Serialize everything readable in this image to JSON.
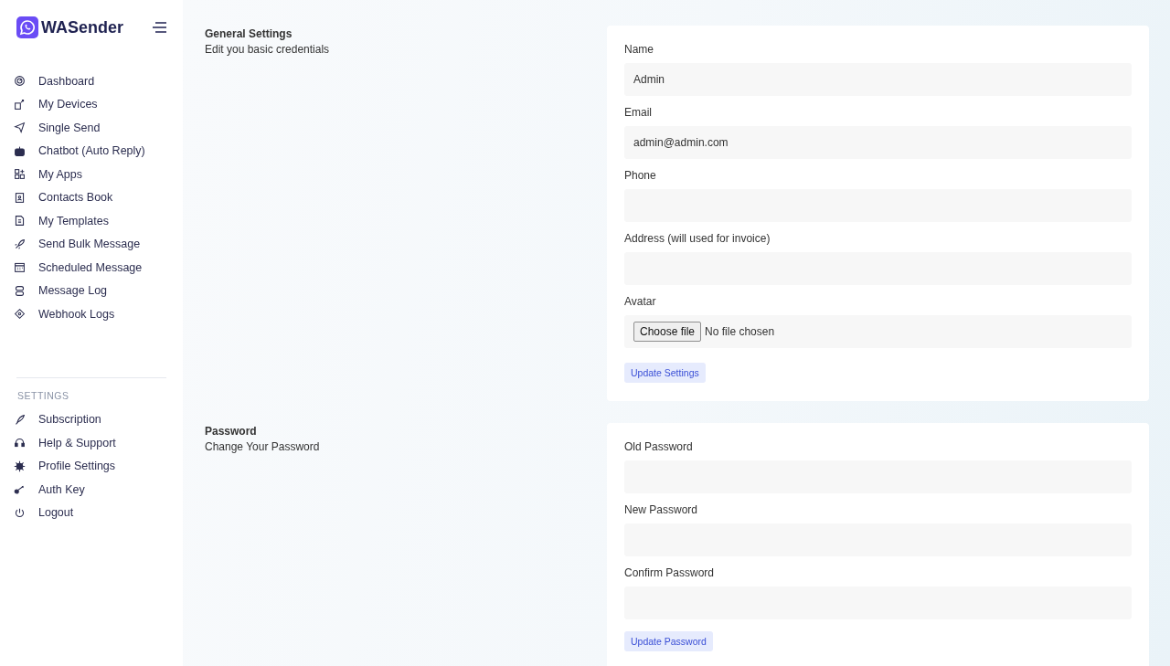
{
  "sidebar": {
    "brand": "WASender",
    "items": [
      {
        "label": "Dashboard",
        "selected": false
      },
      {
        "label": "My Devices",
        "selected": false
      },
      {
        "label": "Single Send",
        "selected": false
      },
      {
        "label": "Chatbot (Auto Reply)",
        "selected": false
      },
      {
        "label": "My Apps",
        "selected": false
      },
      {
        "label": "Contacts Book",
        "selected": false
      },
      {
        "label": "My Templates",
        "selected": false
      },
      {
        "label": "Send Bulk Message",
        "selected": false
      },
      {
        "label": "Scheduled Message",
        "selected": false
      },
      {
        "label": "Message Log",
        "selected": false
      },
      {
        "label": "Webhook Logs",
        "selected": false
      }
    ],
    "settings_heading": "SETTINGS",
    "settings_items": [
      {
        "label": "Subscription",
        "selected": false
      },
      {
        "label": "Help & Support",
        "selected": false
      },
      {
        "label": "Profile Settings",
        "selected": false
      },
      {
        "label": "Auth Key",
        "selected": false
      },
      {
        "label": "Logout",
        "selected": false
      }
    ]
  },
  "sections": [
    {
      "title": "General Settings",
      "subtitle": "Edit you basic credentials",
      "fields": [
        {
          "kind": "text",
          "label": "Name",
          "value": "Admin"
        },
        {
          "kind": "text",
          "label": "Email",
          "value": "admin@admin.com"
        },
        {
          "kind": "text",
          "label": "Phone"
        },
        {
          "kind": "text",
          "label": "Address (will used for invoice)"
        },
        {
          "kind": "file",
          "label": "Avatar",
          "button": "Choose file",
          "status": "No file chosen"
        }
      ],
      "submit": "Update Settings"
    },
    {
      "title": "Password",
      "subtitle": "Change Your Password",
      "fields": [
        {
          "kind": "password",
          "label": "Old Password"
        },
        {
          "kind": "password",
          "label": "New Password"
        },
        {
          "kind": "password",
          "label": "Confirm Password"
        }
      ],
      "submit": "Update Password"
    }
  ]
}
